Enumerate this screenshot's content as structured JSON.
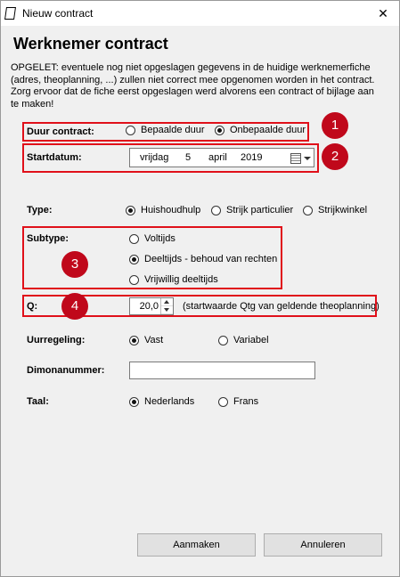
{
  "window": {
    "title": "Nieuw contract",
    "close_glyph": "✕"
  },
  "heading": "Werknemer contract",
  "warning": "OPGELET: eventuele nog niet opgeslagen gegevens in de huidige werknemerfiche (adres, theoplanning, ...) zullen niet correct mee opgenomen worden in het contract. Zorg ervoor dat de fiche eerst opgeslagen werd alvorens een contract of bijlage aan te maken!",
  "duur_contract": {
    "label": "Duur contract:",
    "options": [
      {
        "label": "Bepaalde duur",
        "selected": false
      },
      {
        "label": "Onbepaalde duur",
        "selected": true
      }
    ]
  },
  "startdatum": {
    "label": "Startdatum:",
    "weekday": "vrijdag",
    "day": "5",
    "month": "april",
    "year": "2019"
  },
  "type": {
    "label": "Type:",
    "options": [
      {
        "label": "Huishoudhulp",
        "selected": true
      },
      {
        "label": "Strijk particulier",
        "selected": false
      },
      {
        "label": "Strijkwinkel",
        "selected": false
      }
    ]
  },
  "subtype": {
    "label": "Subtype:",
    "options": [
      {
        "label": "Voltijds",
        "selected": false
      },
      {
        "label": "Deeltijds - behoud van rechten",
        "selected": true
      },
      {
        "label": "Vrijwillig deeltijds",
        "selected": false
      }
    ]
  },
  "q": {
    "label": "Q:",
    "value": "20,0",
    "hint": "(startwaarde Qtg van geldende theoplanning)"
  },
  "uurregeling": {
    "label": "Uurregeling:",
    "options": [
      {
        "label": "Vast",
        "selected": true
      },
      {
        "label": "Variabel",
        "selected": false
      }
    ]
  },
  "dimonanummer": {
    "label": "Dimonanummer:",
    "value": ""
  },
  "taal": {
    "label": "Taal:",
    "options": [
      {
        "label": "Nederlands",
        "selected": true
      },
      {
        "label": "Frans",
        "selected": false
      }
    ]
  },
  "annotations": [
    "1",
    "2",
    "3",
    "4"
  ],
  "buttons": {
    "create": "Aanmaken",
    "cancel": "Annuleren"
  },
  "colors": {
    "annotation_red": "#e0101a",
    "badge_red": "#c0081b",
    "window_bg": "#f0f0f0"
  }
}
